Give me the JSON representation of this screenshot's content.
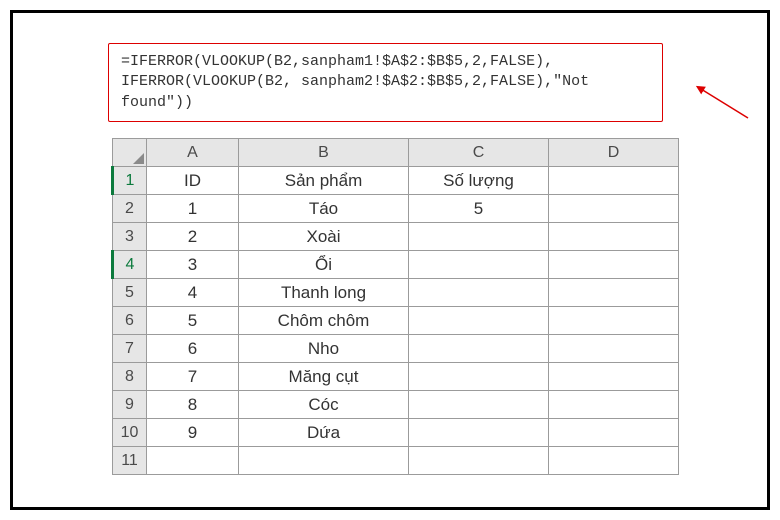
{
  "formula": {
    "line1": "=IFERROR(VLOOKUP(B2,sanpham1!$A$2:$B$5,2,FALSE),",
    "line2": "IFERROR(VLOOKUP(B2, sanpham2!$A$2:$B$5,2,FALSE),\"Not found\"))"
  },
  "columns": [
    "A",
    "B",
    "C",
    "D"
  ],
  "rows": [
    {
      "num": "1",
      "active": true,
      "A": "ID",
      "B": "Sản phẩm",
      "C": "Số lượng",
      "D": ""
    },
    {
      "num": "2",
      "active": false,
      "A": "1",
      "B": "Táo",
      "C": "5",
      "D": ""
    },
    {
      "num": "3",
      "active": false,
      "A": "2",
      "B": "Xoài",
      "C": "",
      "D": ""
    },
    {
      "num": "4",
      "active": true,
      "A": "3",
      "B": "Ổi",
      "C": "",
      "D": ""
    },
    {
      "num": "5",
      "active": false,
      "A": "4",
      "B": "Thanh long",
      "C": "",
      "D": ""
    },
    {
      "num": "6",
      "active": false,
      "A": "5",
      "B": "Chôm chôm",
      "C": "",
      "D": ""
    },
    {
      "num": "7",
      "active": false,
      "A": "6",
      "B": "Nho",
      "C": "",
      "D": ""
    },
    {
      "num": "8",
      "active": false,
      "A": "7",
      "B": "Măng cụt",
      "C": "",
      "D": ""
    },
    {
      "num": "9",
      "active": false,
      "A": "8",
      "B": "Cóc",
      "C": "",
      "D": ""
    },
    {
      "num": "10",
      "active": false,
      "A": "9",
      "B": "Dứa",
      "C": "",
      "D": ""
    },
    {
      "num": "11",
      "active": false,
      "A": "",
      "B": "",
      "C": "",
      "D": ""
    }
  ]
}
